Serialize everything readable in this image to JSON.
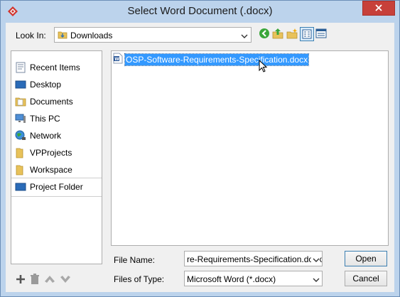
{
  "window": {
    "title": "Select Word Document (.docx)"
  },
  "look_in": {
    "label": "Look In:",
    "value": "Downloads"
  },
  "toolbar": {
    "icons": [
      "back-icon",
      "up-folder-icon",
      "new-folder-icon",
      "list-view-icon",
      "details-view-icon"
    ]
  },
  "places": [
    {
      "label": "Recent Items",
      "icon": "recent-items-icon"
    },
    {
      "label": "Desktop",
      "icon": "desktop-icon"
    },
    {
      "label": "Documents",
      "icon": "documents-icon"
    },
    {
      "label": "This PC",
      "icon": "this-pc-icon"
    },
    {
      "label": "Network",
      "icon": "network-icon"
    },
    {
      "label": "VPProjects",
      "icon": "folder-icon"
    },
    {
      "label": "Workspace",
      "icon": "folder-icon"
    },
    {
      "label": "Project Folder",
      "icon": "project-folder-icon"
    }
  ],
  "files": [
    {
      "name": "OSP-Software-Requirements-Specification.docx",
      "icon": "word-doc-icon",
      "selected": true
    }
  ],
  "file_name": {
    "label": "File Name:",
    "value": "re-Requirements-Specification.docx"
  },
  "file_type": {
    "label": "Files of Type:",
    "value": "Microsoft Word (*.docx)"
  },
  "buttons": {
    "open": "Open",
    "cancel": "Cancel"
  },
  "colors": {
    "frame": "#bcd3ec",
    "close": "#c7403a",
    "selection": "#3399ff"
  }
}
